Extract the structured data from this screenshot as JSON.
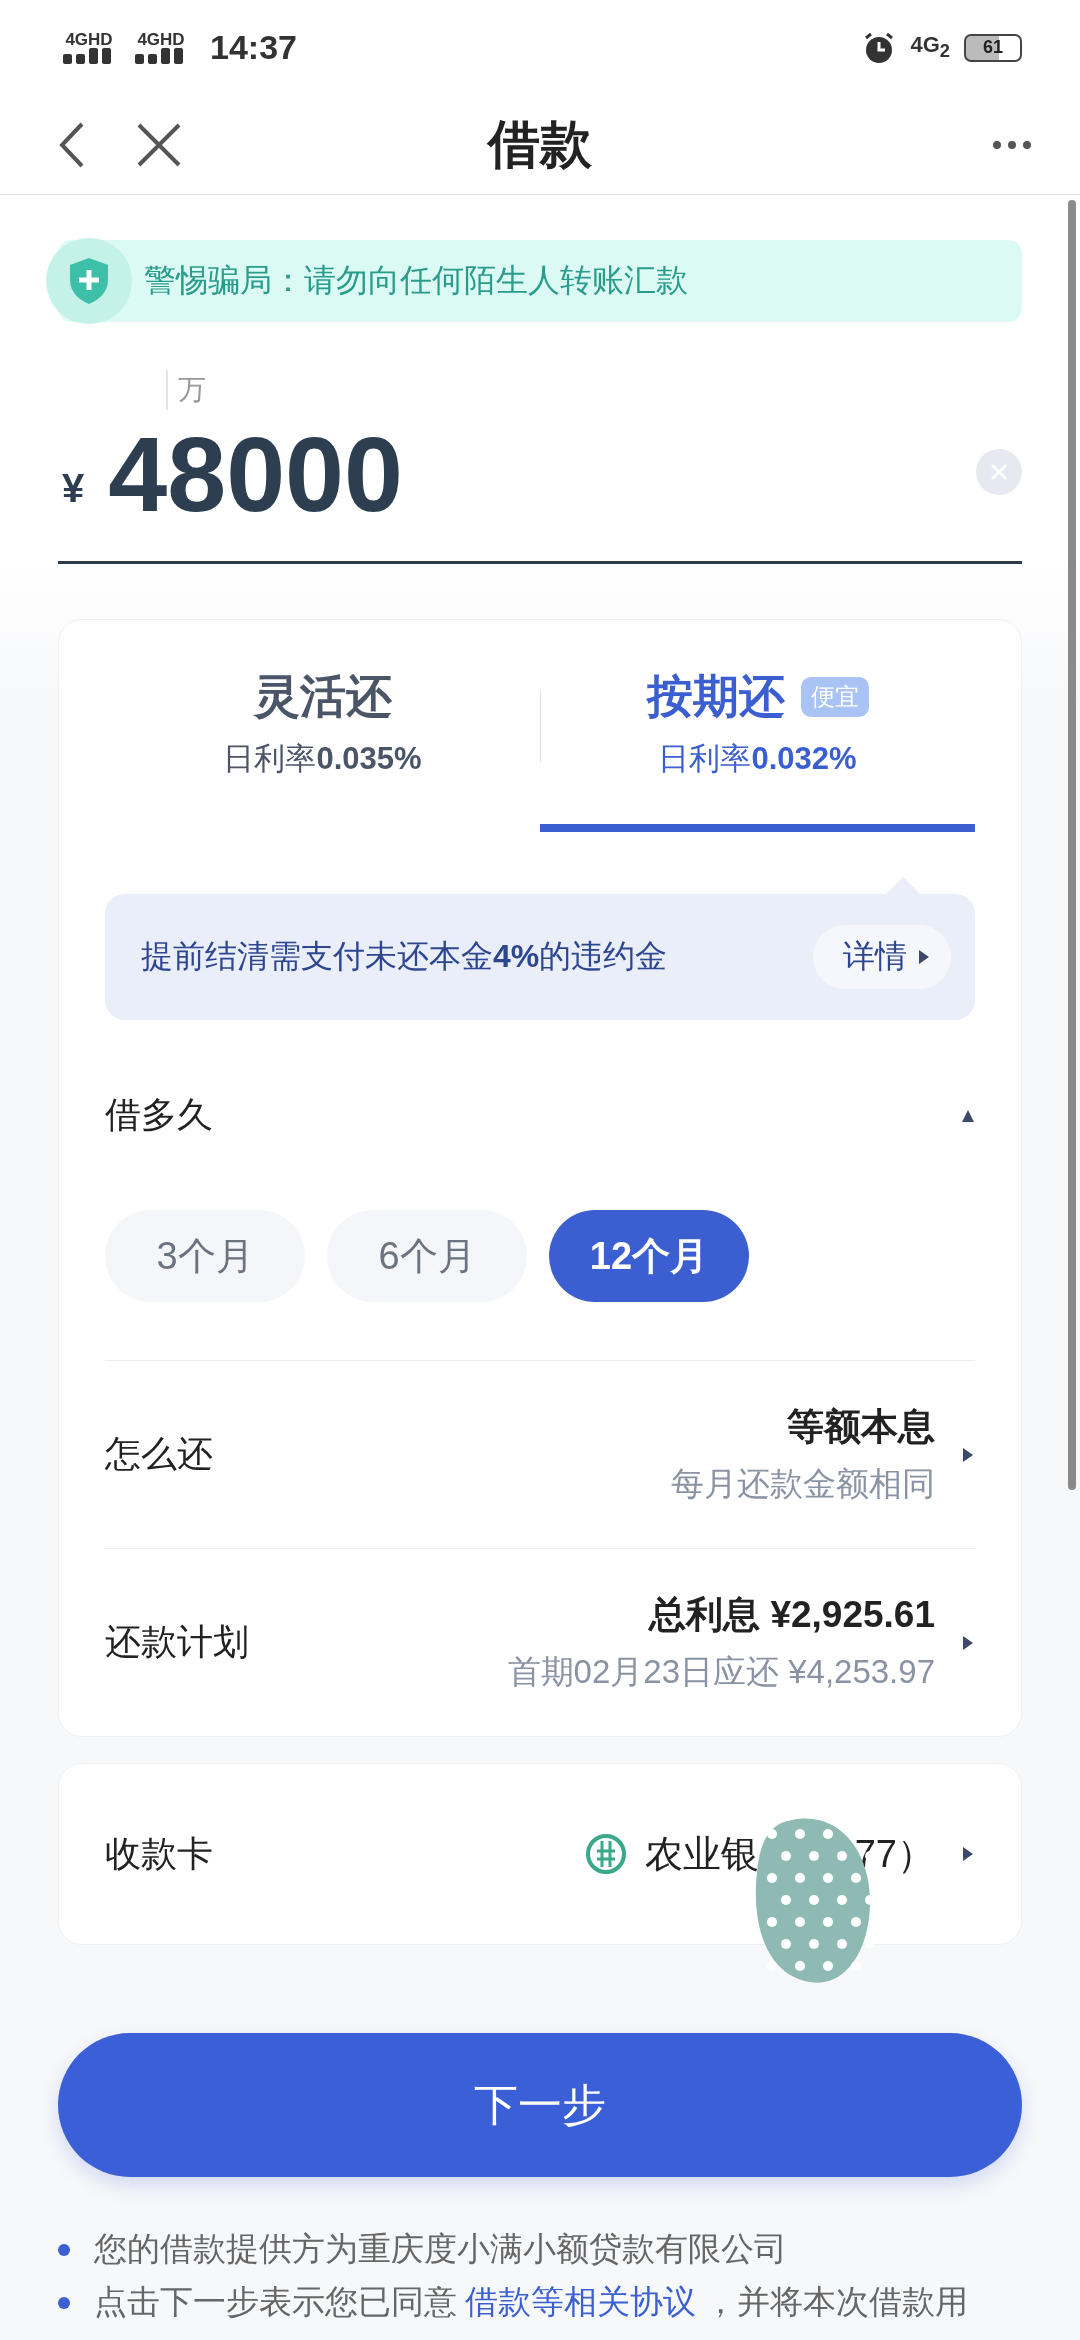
{
  "status_bar": {
    "signal_1": "4GHD",
    "signal_2": "4GHD",
    "time": "14:37",
    "network": "4G$_{2}$",
    "battery": "61"
  },
  "header": {
    "title": "借款"
  },
  "alert": {
    "text": "警惕骗局：请勿向任何陌生人转账汇款"
  },
  "amount": {
    "unit_hint": "万",
    "currency": "¥",
    "value": "48000"
  },
  "repay_tabs": [
    {
      "label": "灵活还",
      "rate_label": "日利率",
      "rate": "0.035%",
      "selected": false
    },
    {
      "label": "按期还",
      "badge": "便宜",
      "rate_label": "日利率",
      "rate": "0.032%",
      "selected": true
    }
  ],
  "notice": {
    "text": "提前结清需支付未还本金**4%**的违约金",
    "button": "详情"
  },
  "term": {
    "label": "借多久",
    "expanded": true,
    "options": [
      {
        "label": "3个月",
        "selected": false
      },
      {
        "label": "6个月",
        "selected": false
      },
      {
        "label": "12个月",
        "selected": true
      }
    ]
  },
  "rows": [
    {
      "label": "怎么还",
      "value": "等额本息",
      "sub": "每月还款金额相同"
    },
    {
      "label": "还款计划",
      "value": "总利息 ¥2,925.61",
      "sub": "首期02月23日应还 ¥4,253.97"
    }
  ],
  "card": {
    "label": "收款卡",
    "bank_prefix": "农业银",
    "bank_suffix": "77）"
  },
  "next_button": "下一步",
  "footer": [
    {
      "text": "您的借款提供方为重庆度小满小额贷款有限公司"
    },
    {
      "text": "点击下一步表示您已同意",
      "link": "借款等相关协议",
      "after": "，并将本次借款用"
    }
  ]
}
